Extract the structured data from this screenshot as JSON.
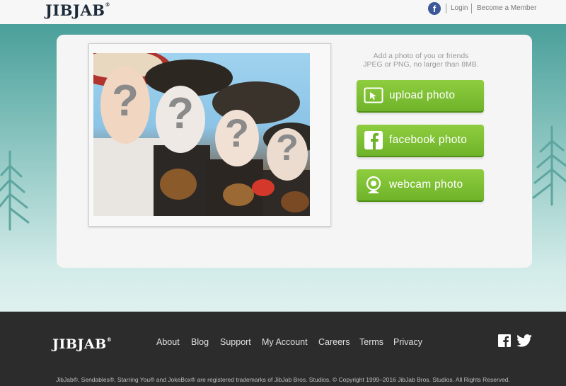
{
  "header": {
    "logo": "JIBJAB",
    "logo_mark": "®",
    "facebook_icon_glyph": "f",
    "login_label": "Login",
    "become_member_label": "Become a Member"
  },
  "upload": {
    "instructions_line1": "Add a photo of you or friends",
    "instructions_line2": "JPEG or PNG, no larger than 8MB.",
    "buttons": [
      {
        "label": "upload photo",
        "icon": "upload-cursor-icon"
      },
      {
        "label": "facebook photo",
        "icon": "facebook-icon"
      },
      {
        "label": "webcam photo",
        "icon": "webcam-icon"
      }
    ],
    "face_placeholder_glyph": "?",
    "button_color": "#72b52d"
  },
  "footer": {
    "logo": "JIBJAB",
    "logo_mark": "®",
    "nav": [
      "About",
      "Blog",
      "Support",
      "My Account",
      "Careers",
      "Terms",
      "Privacy"
    ],
    "social": [
      "facebook-icon",
      "twitter-icon"
    ],
    "legal": "JibJab®, Sendables®, Starring You® and JokeBox® are registered trademarks of JibJab Bros. Studios. © Copyright 1999–2016 JibJab Bros. Studios. All Rights Reserved."
  }
}
